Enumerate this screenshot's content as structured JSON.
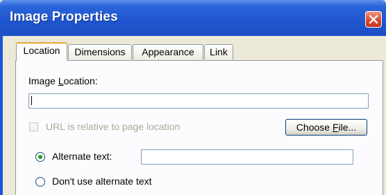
{
  "window": {
    "title": "Image Properties",
    "close_icon": "close-icon"
  },
  "tabs": [
    {
      "label": "Location",
      "active": true
    },
    {
      "label": "Dimensions",
      "active": false
    },
    {
      "label": "Appearance",
      "active": false
    },
    {
      "label": "Link",
      "active": false
    }
  ],
  "location": {
    "image_location_label_pre": "Image ",
    "image_location_label_mnemonic": "L",
    "image_location_label_post": "ocation:",
    "image_location_value": "",
    "url_relative_label": "URL is relative to page location",
    "url_relative_checked": false,
    "choose_file_pre": "Choose ",
    "choose_file_mnemonic": "F",
    "choose_file_post": "ile...",
    "alternate_text_label": "Alternate text:",
    "alternate_text_value": "",
    "alternate_text_selected": true,
    "no_alt_text_label": "Don't use alternate text",
    "no_alt_text_selected": false
  },
  "colors": {
    "titlebar": "#1f55cf",
    "dialog_bg": "#ece9d8",
    "active_tab_accent": "#e8a732",
    "close_button": "#d9432a"
  }
}
